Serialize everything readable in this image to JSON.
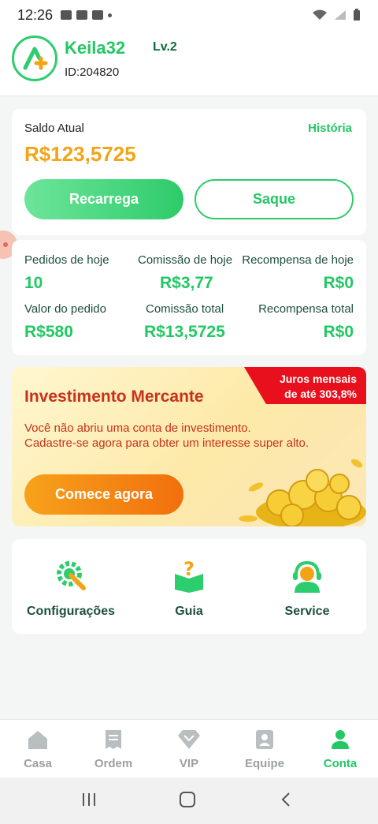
{
  "status_bar": {
    "time": "12:26"
  },
  "header": {
    "username": "Keila32",
    "level": "Lv.2",
    "user_id": "ID:204820",
    "logo_icon": "app-logo-icon",
    "brand_color": "#22c863"
  },
  "balance": {
    "label": "Saldo Atual",
    "history_link": "História",
    "amount": "R$123,5725",
    "recharge_button": "Recarrega",
    "withdraw_button": "Saque"
  },
  "stats": {
    "orders_today_label": "Pedidos de hoje",
    "orders_today_value": "10",
    "commission_today_label": "Comissão de hoje",
    "commission_today_value": "R$3,77",
    "reward_today_label": "Recompensa de hoje",
    "reward_today_value": "R$0",
    "order_value_label": "Valor do pedido",
    "order_value_value": "R$580",
    "commission_total_label": "Comissão total",
    "commission_total_value": "R$13,5725",
    "reward_total_label": "Recompensa total",
    "reward_total_value": "R$0"
  },
  "investment": {
    "badge_line1": "Juros mensais",
    "badge_line2": "de até 303,8%",
    "title": "Investimento Mercante",
    "text_line1": "Você não abriu uma conta de investimento.",
    "text_line2": "Cadastre-se agora para obter um interesse super alto.",
    "button": "Comece agora"
  },
  "menu": {
    "items": [
      {
        "label": "Configurações",
        "icon": "gear-wrench-icon"
      },
      {
        "label": "Guia",
        "icon": "guide-book-icon"
      },
      {
        "label": "Service",
        "icon": "headset-service-icon"
      }
    ]
  },
  "bottom_nav": {
    "items": [
      {
        "label": "Casa",
        "icon": "home-icon"
      },
      {
        "label": "Ordem",
        "icon": "receipt-icon"
      },
      {
        "label": "VIP",
        "icon": "diamond-icon"
      },
      {
        "label": "Equipe",
        "icon": "team-icon"
      },
      {
        "label": "Conta",
        "icon": "account-icon"
      }
    ],
    "active": "Conta"
  }
}
